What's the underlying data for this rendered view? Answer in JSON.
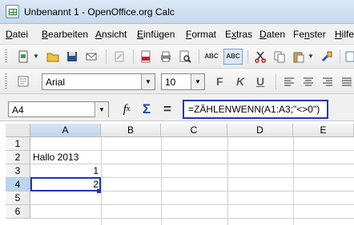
{
  "window": {
    "title": "Unbenannt 1 - OpenOffice.org Calc"
  },
  "menu": [
    "Datei",
    "Bearbeiten",
    "Ansicht",
    "Einfügen",
    "Format",
    "Extras",
    "Daten",
    "Fenster",
    "Hilfe"
  ],
  "menu_underline": [
    "D",
    "B",
    "A",
    "E",
    "F",
    "x",
    "D",
    "n",
    "H"
  ],
  "toolbar": {
    "icons": [
      "new-document-icon",
      "open-folder-icon",
      "save-icon",
      "email-icon",
      "edit-file-icon",
      "export-pdf-icon",
      "print-icon",
      "page-preview-icon",
      "spellcheck-icon",
      "autospellcheck-icon",
      "cut-icon",
      "copy-icon",
      "paste-icon",
      "clone-formatting-icon"
    ]
  },
  "formatting": {
    "font_name": "Arial",
    "font_size": "10",
    "bold": "F",
    "italic": "K",
    "underline": "U"
  },
  "formula_bar": {
    "name_box": "A4",
    "wizard_symbol": "f(x)",
    "sum_symbol": "Σ",
    "equals_symbol": "=",
    "formula": "=ZÄHLENWENN(A1:A3;\"<>0\")"
  },
  "sheet": {
    "columns": [
      "A",
      "B",
      "C",
      "D",
      "E"
    ],
    "rows": [
      "1",
      "2",
      "3",
      "4",
      "5",
      "6"
    ],
    "active_cell": "A4",
    "cells": {
      "A2": "Hallo 2013",
      "A3": "1",
      "A4": "2"
    }
  }
}
